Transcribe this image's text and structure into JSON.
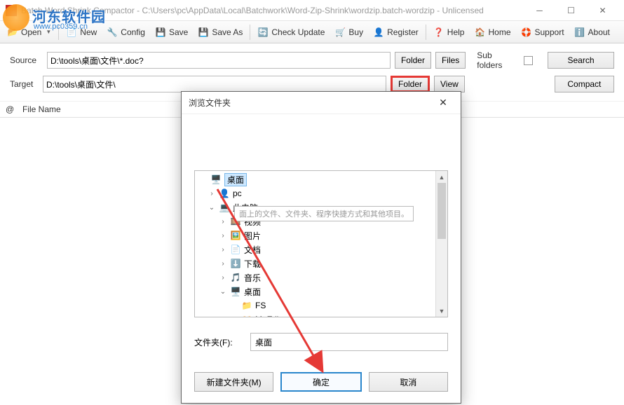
{
  "window": {
    "title": "Batch Word Shrink Compactor - C:\\Users\\pc\\AppData\\Local\\Batchwork\\Word-Zip-Shrink\\wordzip.batch-wordzip - Unlicensed"
  },
  "toolbar": {
    "open": "Open",
    "new": "New",
    "config": "Config",
    "save": "Save",
    "save_as": "Save As",
    "check_update": "Check Update",
    "buy": "Buy",
    "register": "Register",
    "help": "Help",
    "home": "Home",
    "support": "Support",
    "about": "About"
  },
  "paths": {
    "source_label": "Source",
    "source_value": "D:\\tools\\桌面\\文件\\*.doc?",
    "target_label": "Target",
    "target_value": "D:\\tools\\桌面\\文件\\",
    "folder_btn": "Folder",
    "files_btn": "Files",
    "view_btn": "View",
    "subfolders_label": "Sub folders",
    "search_btn": "Search",
    "compact_btn": "Compact"
  },
  "filelist": {
    "col_at": "@",
    "col_name": "File Name"
  },
  "dialog": {
    "title": "浏览文件夹",
    "tooltip": "面上的文件、文件夹、程序快捷方式和其他项目。",
    "tree": [
      {
        "depth": 0,
        "expander": "",
        "icon": "desktop",
        "label": "桌面",
        "selected": true
      },
      {
        "depth": 1,
        "expander": ">",
        "icon": "user",
        "label": "pc"
      },
      {
        "depth": 1,
        "expander": "v",
        "icon": "computer",
        "label": "此电脑"
      },
      {
        "depth": 2,
        "expander": ">",
        "icon": "video",
        "label": "视频"
      },
      {
        "depth": 2,
        "expander": ">",
        "icon": "pictures",
        "label": "图片"
      },
      {
        "depth": 2,
        "expander": ">",
        "icon": "documents",
        "label": "文档"
      },
      {
        "depth": 2,
        "expander": ">",
        "icon": "downloads",
        "label": "下载"
      },
      {
        "depth": 2,
        "expander": ">",
        "icon": "music",
        "label": "音乐"
      },
      {
        "depth": 2,
        "expander": "v",
        "icon": "desktop",
        "label": "桌面"
      },
      {
        "depth": 3,
        "expander": "",
        "icon": "folder",
        "label": "FS"
      },
      {
        "depth": 3,
        "expander": "",
        "icon": "folder",
        "label": "M..E.lit"
      }
    ],
    "foldername_label": "文件夹(F):",
    "foldername_value": "桌面",
    "new_folder_btn": "新建文件夹(M)",
    "ok_btn": "确定",
    "cancel_btn": "取消"
  },
  "watermark": {
    "title": "河东软件园",
    "url": "www.pc0359.cn"
  }
}
